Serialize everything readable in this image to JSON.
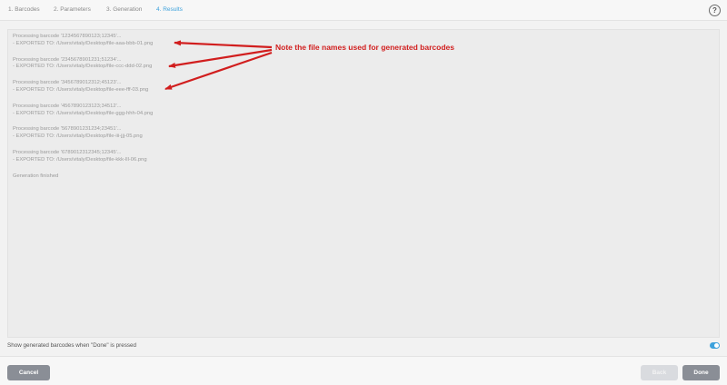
{
  "tabs": [
    {
      "label": "1. Barcodes",
      "active": false
    },
    {
      "label": "2. Parameters",
      "active": false
    },
    {
      "label": "3. Generation",
      "active": false
    },
    {
      "label": "4. Results",
      "active": true
    }
  ],
  "help_label": "?",
  "log": {
    "entries": [
      {
        "processing": "Processing barcode '1234567890123;12345'...",
        "exported": " - EXPORTED TO: /Users/vitaly/Desktop/file-aaa-bbb-01.png"
      },
      {
        "processing": "Processing barcode '2345678901231;51234'...",
        "exported": " - EXPORTED TO: /Users/vitaly/Desktop/file-ccc-ddd-02.png"
      },
      {
        "processing": "Processing barcode '3456789012312;45123'...",
        "exported": " - EXPORTED TO: /Users/vitaly/Desktop/file-eee-fff-03.png"
      },
      {
        "processing": "Processing barcode '4567890123123;34512'...",
        "exported": " - EXPORTED TO: /Users/vitaly/Desktop/file-ggg-hhh-04.png"
      },
      {
        "processing": "Processing barcode '5678901231234;23451'...",
        "exported": " - EXPORTED TO: /Users/vitaly/Desktop/file-iii-jjj-05.png"
      },
      {
        "processing": "Processing barcode '6789012312345;12345'...",
        "exported": " - EXPORTED TO: /Users/vitaly/Desktop/file-kkk-lll-06.png"
      }
    ],
    "finished": "Generation finished"
  },
  "annotation": "Note the file names used for generated barcodes",
  "option": {
    "label": "Show generated barcodes when \"Done\" is pressed",
    "enabled": true
  },
  "buttons": {
    "cancel": "Cancel",
    "back": "Back",
    "done": "Done"
  },
  "colors": {
    "accent": "#3ea2dc",
    "annotation": "#d11e1e",
    "button": "#8a8e96"
  }
}
